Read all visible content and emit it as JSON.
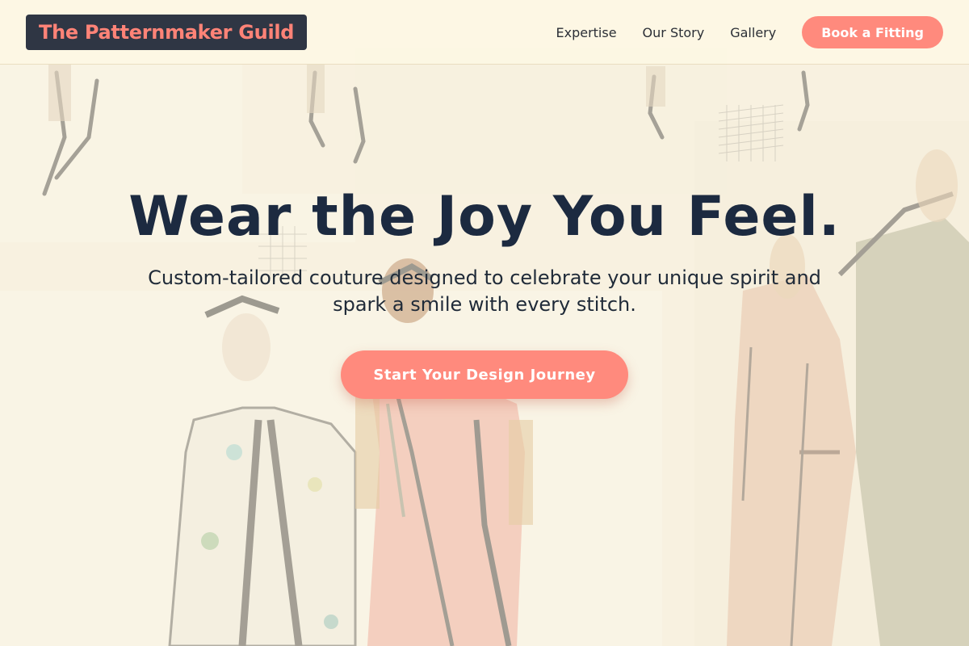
{
  "header": {
    "brand": "The Patternmaker Guild",
    "nav": {
      "items": [
        {
          "label": "Expertise"
        },
        {
          "label": "Our Story"
        },
        {
          "label": "Gallery"
        }
      ],
      "cta_label": "Book a Fitting"
    }
  },
  "hero": {
    "title": "Wear the Joy You Feel.",
    "subtitle": "Custom-tailored couture designed to celebrate your unique spirit and spark a smile with every stitch.",
    "cta_label": "Start Your Design Journey",
    "background": "fashion-sketch-illustration"
  },
  "colors": {
    "accent": "#ff8a7d",
    "brand_text": "#ff8377",
    "brand_bg": "#2f3644",
    "heading": "#1c2a40",
    "page_bg": "#f5efdf"
  }
}
